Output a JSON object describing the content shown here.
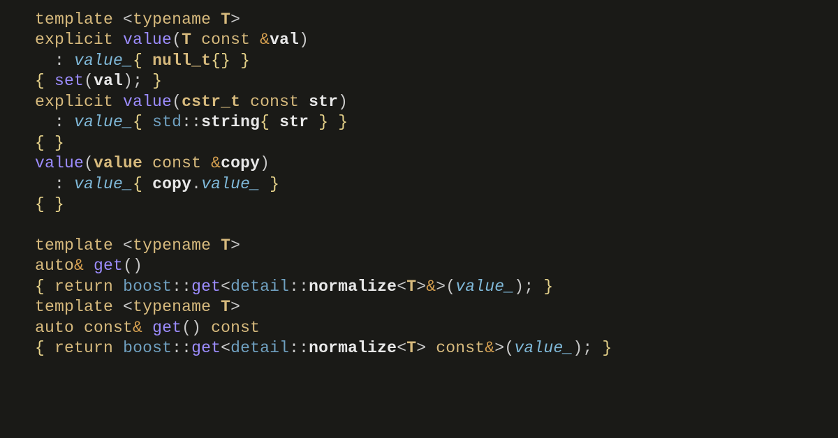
{
  "code": {
    "tokens": {
      "template": "template",
      "typename": "typename",
      "T": "T",
      "explicit": "explicit",
      "value": "value",
      "const": "const",
      "val": "val",
      "value_field": "value_",
      "null_t": "null_t",
      "set": "set",
      "cstr_t": "cstr_t",
      "str": "str",
      "std": "std",
      "string": "string",
      "copy": "copy",
      "auto": "auto",
      "get": "get",
      "return": "return",
      "boost": "boost",
      "detail": "detail",
      "normalize": "normalize",
      "amp": "&",
      "lt": "<",
      "gt": ">",
      "lparen": "(",
      "rparen": ")",
      "lbrace": "{",
      "rbrace": "}",
      "colon": ":",
      "semicolon": ";",
      "dot": ".",
      "dcolon": "::"
    }
  }
}
